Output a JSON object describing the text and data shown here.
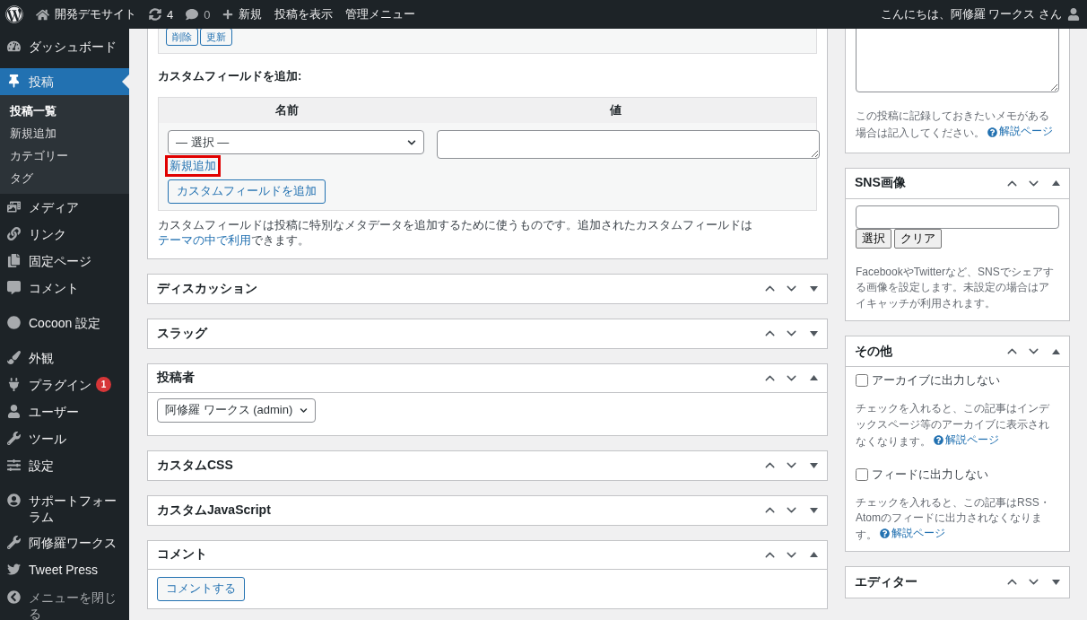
{
  "admin_bar": {
    "site_name": "開発デモサイト",
    "updates": "4",
    "comments": "0",
    "new_label": "新規",
    "view_post": "投稿を表示",
    "admin_menu": "管理メニュー",
    "greeting": "こんにちは、阿修羅 ワークス さん"
  },
  "sidebar": {
    "groups": [
      [
        {
          "label": "ダッシュボード",
          "selected": false
        }
      ],
      [
        {
          "label": "投稿",
          "selected": true,
          "children": [
            {
              "label": "投稿一覧",
              "selected": true
            },
            {
              "label": "新規追加",
              "selected": false
            },
            {
              "label": "カテゴリー",
              "selected": false
            },
            {
              "label": "タグ",
              "selected": false
            }
          ]
        },
        {
          "label": "メディア",
          "selected": false
        },
        {
          "label": "リンク",
          "selected": false
        },
        {
          "label": "固定ページ",
          "selected": false
        },
        {
          "label": "コメント",
          "selected": false
        }
      ],
      [
        {
          "label": "Cocoon 設定",
          "selected": false
        }
      ],
      [
        {
          "label": "外観",
          "selected": false
        },
        {
          "label": "プラグイン",
          "selected": false,
          "badge": "1"
        },
        {
          "label": "ユーザー",
          "selected": false
        },
        {
          "label": "ツール",
          "selected": false
        },
        {
          "label": "設定",
          "selected": false
        }
      ],
      [
        {
          "label": "サポートフォーラム",
          "selected": false
        },
        {
          "label": "阿修羅ワークス",
          "selected": false
        },
        {
          "label": "Tweet Press",
          "selected": false
        }
      ]
    ],
    "collapse_label": "メニューを閉じる"
  },
  "custom_fields": {
    "buttons": [
      "削除",
      "更新"
    ],
    "heading": "カスタムフィールドを追加:",
    "columns": [
      "名前",
      "値"
    ],
    "select_value": "— 選択 —",
    "new_link": {
      "label": "新規追加",
      "highlighted": true
    },
    "add_button": "カスタムフィールドを追加",
    "note_start": "カスタムフィールドは投稿に特別なメタデータを追加するために使うものです。追加されたカスタムフィールドは",
    "note_link": "テーマの中で利用",
    "note_end": "できます。"
  },
  "main_boxes": [
    {
      "kind": "plain",
      "title": "ディスカッション",
      "expanded": false
    },
    {
      "kind": "plain",
      "title": "スラッグ",
      "expanded": false
    },
    {
      "kind": "select",
      "title": "投稿者",
      "expanded": true,
      "value": "阿修羅 ワークス (admin)"
    },
    {
      "kind": "plain",
      "title": "カスタムCSS",
      "expanded": false
    },
    {
      "kind": "plain",
      "title": "カスタムJavaScript",
      "expanded": false
    },
    {
      "kind": "button",
      "title": "コメント",
      "expanded": true,
      "button": "コメントする"
    }
  ],
  "side_boxes": [
    {
      "kind": "memo",
      "text": "この投稿に記録しておきたいメモがある場合は記入してください。",
      "help": "解説ページ"
    },
    {
      "kind": "image",
      "title": "SNS画像",
      "expanded": true,
      "buttons": [
        "選択",
        "クリア"
      ],
      "text": "FacebookやTwitterなど、SNSでシェアする画像を設定します。未設定の場合はアイキャッチが利用されます。"
    },
    {
      "kind": "options",
      "title": "その他",
      "expanded": true,
      "options": [
        {
          "label": "アーカイブに出力しない",
          "checked": false,
          "text": "チェックを入れると、この記事はインデックスページ等のアーカイブに表示されなくなります。",
          "help": "解説ページ"
        },
        {
          "label": "フィードに出力しない",
          "checked": false,
          "text": "チェックを入れると、この記事はRSS・Atomのフィードに出力されなくなります。",
          "help": "解説ページ"
        }
      ]
    },
    {
      "kind": "plain",
      "title": "エディター",
      "expanded": false
    }
  ]
}
